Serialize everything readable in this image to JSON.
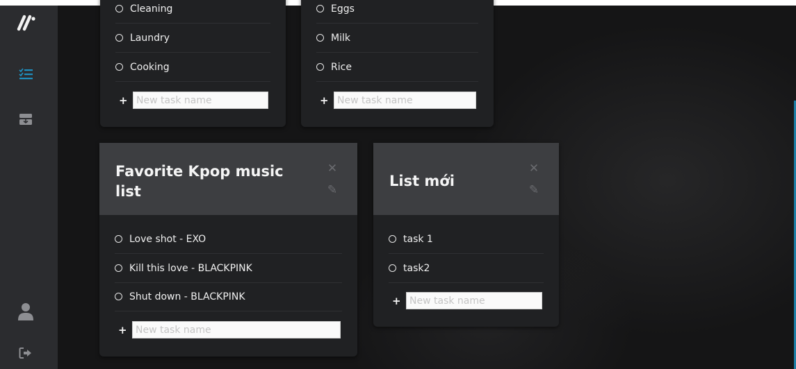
{
  "app": {
    "logo": "//",
    "accent": "#1e90c0"
  },
  "sidebar": {
    "items": [
      {
        "icon": "logo-icon"
      },
      {
        "icon": "tasks-list-icon",
        "active": true
      },
      {
        "icon": "archive-tray-icon"
      },
      {
        "icon": "user-icon"
      },
      {
        "icon": "logout-icon"
      }
    ]
  },
  "lists": [
    {
      "title": "",
      "tasks": [
        "Cleaning",
        "Laundry",
        "Cooking"
      ],
      "new_task_placeholder": "New task name"
    },
    {
      "title": "",
      "tasks": [
        "Eggs",
        "Milk",
        "Rice"
      ],
      "new_task_placeholder": "New task name"
    },
    {
      "title": "Favorite Kpop music list",
      "tasks": [
        "Love shot - EXO",
        "Kill this love - BLACKPINK",
        "Shut down - BLACKPINK"
      ],
      "new_task_placeholder": "New task name",
      "close_symbol": "✕",
      "edit_symbol": "✎"
    },
    {
      "title": "List mới",
      "tasks": [
        "task 1",
        "task2"
      ],
      "new_task_placeholder": "New task name",
      "close_symbol": "✕",
      "edit_symbol": "✎"
    }
  ],
  "new_task_symbol": "+"
}
